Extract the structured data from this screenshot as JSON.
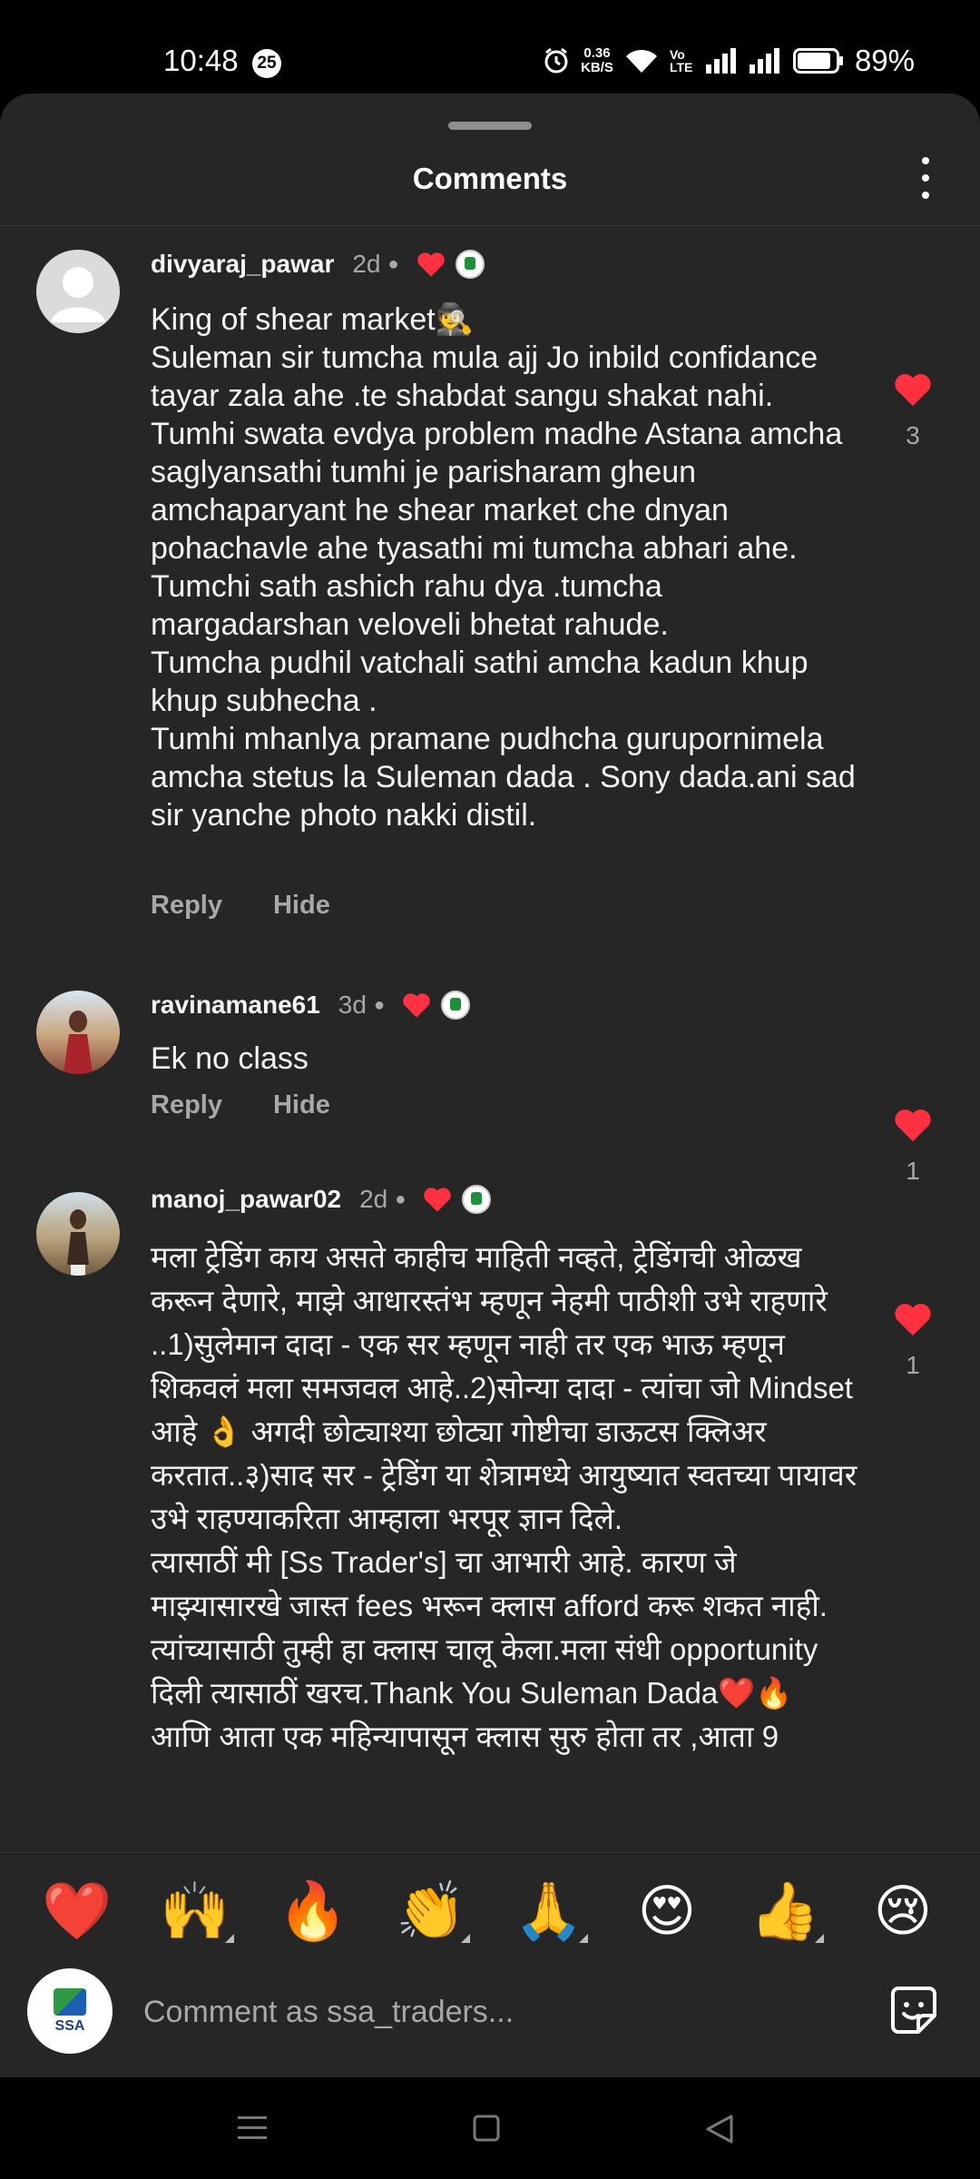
{
  "status": {
    "time": "10:48",
    "notif_count": "25",
    "speed_value": "0.36",
    "speed_unit": "KB/S",
    "volte": "Vo LTE",
    "battery": "89%",
    "battery_level": 0.89
  },
  "sheet": {
    "title": "Comments"
  },
  "comments": [
    {
      "username": "divyaraj_pawar",
      "time": "2d",
      "text": "King of shear market🕵️\nSuleman sir tumcha mula ajj Jo inbild confidance tayar zala ahe .te shabdat sangu shakat nahi. Tumhi swata evdya problem madhe Astana amcha\nsaglyansathi tumhi je parisharam gheun amchaparyant he shear market che dnyan pohachavle ahe tyasathi mi tumcha abhari ahe.\nTumchi sath ashich rahu dya .tumcha margadarshan veloveli bhetat rahude.\nTumcha pudhil vatchali sathi amcha kadun khup khup subhecha .\nTumhi mhanlya pramane pudhcha gurupornimela amcha stetus la Suleman dada . Sony dada.ani sad sir yanche photo nakki distil.",
      "reply": "Reply",
      "hide": "Hide",
      "likes": "3"
    },
    {
      "username": "ravinamane61",
      "time": "3d",
      "text": "Ek no class",
      "reply": "Reply",
      "hide": "Hide",
      "likes": "1"
    },
    {
      "username": "manoj_pawar02",
      "time": "2d",
      "text": "मला ट्रेडिंग काय असते काहीच माहिती नव्हते, ट्रेडिंगची ओळख करून देणारे, माझे आधारस्तंभ म्हणून नेहमी पाठीशी उभे राहणारे ..1)सुलेमान दादा - एक सर म्हणून नाही तर एक भाऊ म्हणून शिकवलं मला समजवल आहे..2)सोन्या दादा - त्यांचा जो Mindset आहे 👌 अगदी छोट्याश्या छोट्या गोष्टीचा डाऊटस क्लिअर करतात..३)साद सर - ट्रेडिंग या शेत्रामध्ये आयुष्यात स्वतच्या पायावर उभे राहण्याकरिता आम्हाला भरपूर ज्ञान दिले.\nत्यासाठीं मी [Ss Trader's] चा आभारी आहे. कारण जे माझ्यासारखे जास्त fees भरून क्लास afford करू शकत नाही. त्यांच्यासाठी तुम्ही हा क्लास चालू केला.मला संधी opportunity दिली त्यासाठीं खरच.Thank You Suleman Dada❤️🔥\nआणि आता एक महिन्यापासून क्लास सुरु होता तर ,आता 9",
      "likes": "1"
    }
  ],
  "reactions": [
    "❤️",
    "🙌",
    "🔥",
    "👏",
    "🙏",
    "😍",
    "👍",
    "😢"
  ],
  "composer": {
    "placeholder": "Comment as ssa_traders...",
    "avatar_text": "SSA"
  },
  "colors": {
    "sheet_bg": "#262626",
    "like_red": "#ff3040",
    "muted": "#a8a8a8"
  }
}
